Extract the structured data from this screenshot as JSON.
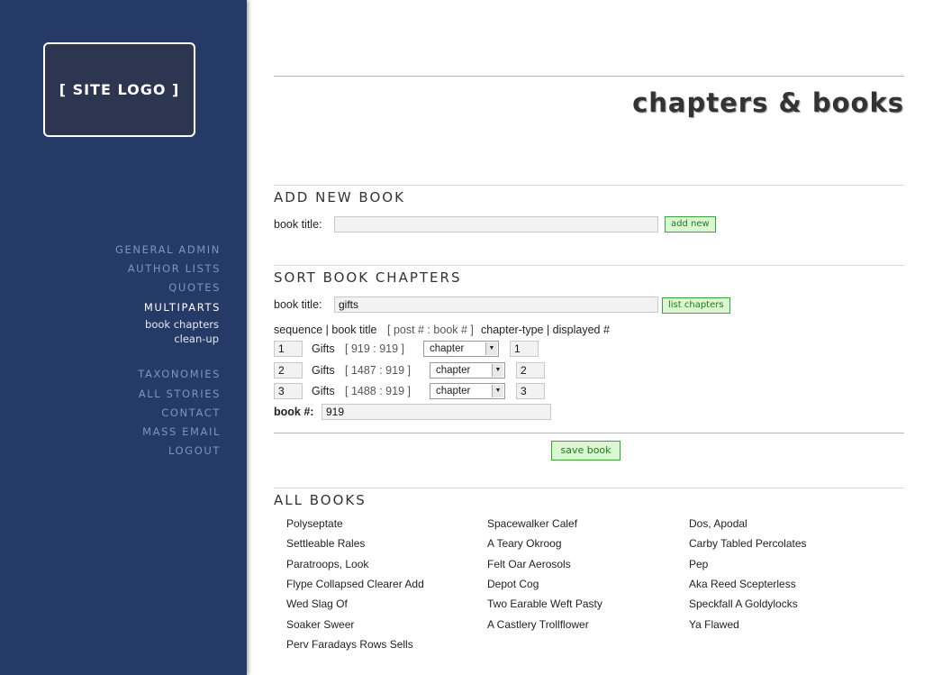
{
  "logo": {
    "text": "[ SITE LOGO ]"
  },
  "nav": {
    "items": [
      "GENERAL ADMIN",
      "AUTHOR LISTS",
      "QUOTES",
      "MULTIPARTS"
    ],
    "sub_items": [
      "book chapters",
      "clean-up"
    ],
    "items2": [
      "TAXONOMIES",
      "ALL STORIES",
      "CONTACT",
      "MASS EMAIL",
      "LOGOUT"
    ]
  },
  "page_title": "chapters & books",
  "add_new": {
    "section_title": "ADD NEW BOOK",
    "book_title_label": "book title:",
    "book_title_value": "",
    "add_button": "add new"
  },
  "sort": {
    "section_title": "SORT BOOK CHAPTERS",
    "book_title_label": "book title:",
    "book_title_value": "gifts",
    "list_button": "list chapters",
    "header_sequence": "sequence | book title",
    "header_post": "[ post # : book # ]",
    "header_rest": "chapter-type | displayed #",
    "rows": [
      {
        "sequence": "1",
        "title": "Gifts",
        "ids": "[ 919 : 919 ]",
        "type": "chapter",
        "displayed": "1"
      },
      {
        "sequence": "2",
        "title": "Gifts",
        "ids": "[ 1487 : 919 ]",
        "type": "chapter",
        "displayed": "2"
      },
      {
        "sequence": "3",
        "title": "Gifts",
        "ids": "[ 1488 : 919 ]",
        "type": "chapter",
        "displayed": "3"
      }
    ],
    "book_num_label": "book #:",
    "book_num_value": "919",
    "save_button": "save book"
  },
  "all_books": {
    "section_title": "ALL BOOKS",
    "col1": [
      "Polyseptate",
      "Settleable Rales",
      "Paratroops, Look",
      "Flype Collapsed Clearer Add",
      "Wed Slag Of",
      "Soaker Sweer",
      "Perv Faradays Rows Sells"
    ],
    "col2": [
      "Spacewalker Calef",
      "A Teary Okroog",
      "Felt Oar Aerosols",
      "Depot Cog",
      "Two Earable Weft Pasty",
      "A Castlery Trollflower"
    ],
    "col3": [
      "Dos, Apodal",
      "Carby Tabled Percolates",
      "Pep",
      "Aka Reed Scepterless",
      "Speckfall A Goldylocks",
      "Ya Flawed"
    ]
  }
}
